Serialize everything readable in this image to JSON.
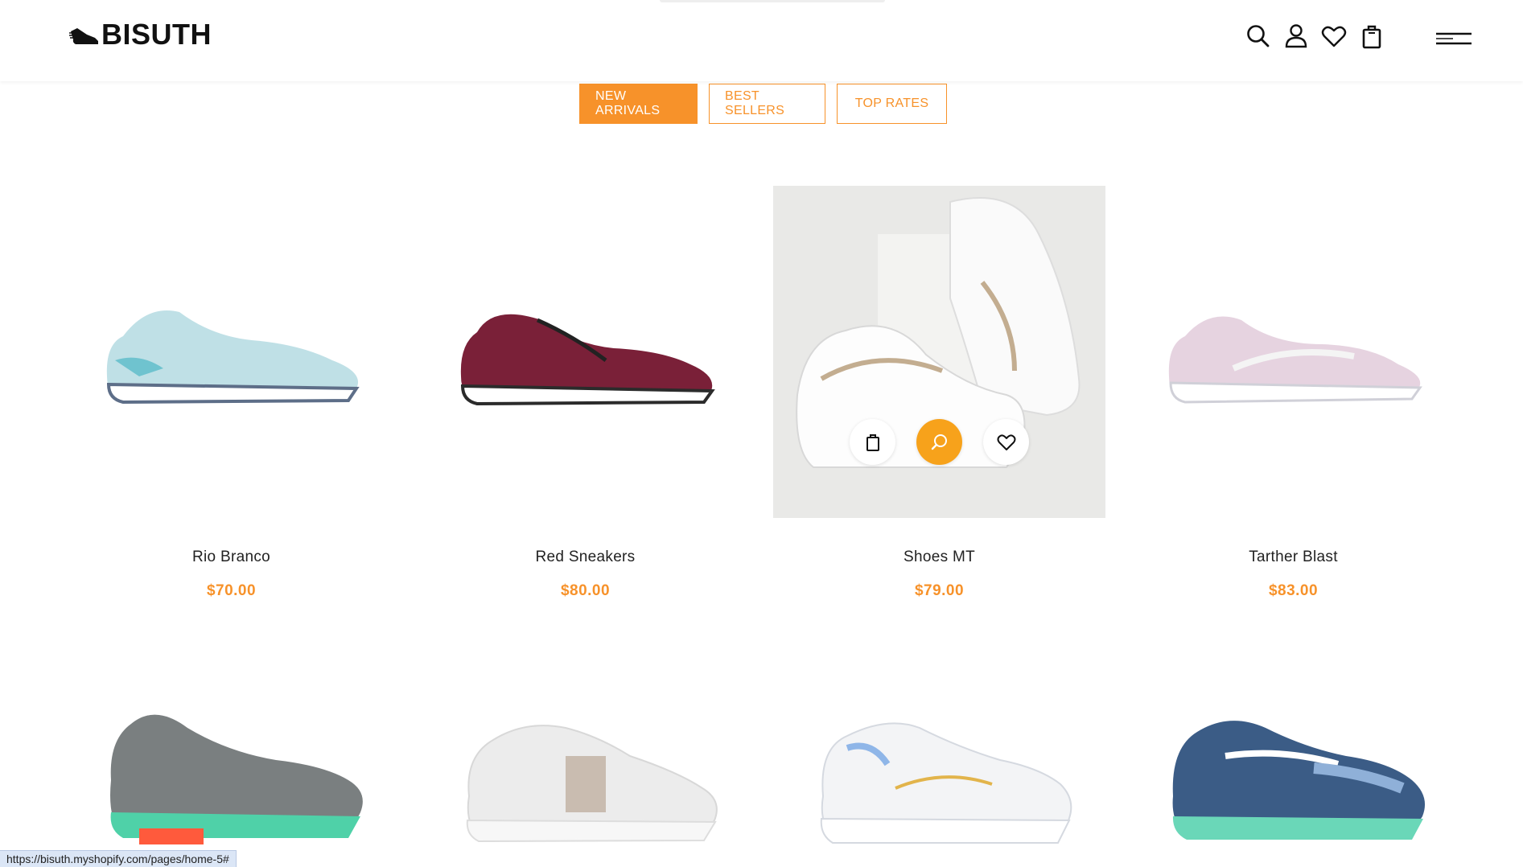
{
  "header": {
    "logo_text": "BISUTH",
    "icons": [
      "search-icon",
      "user-icon",
      "heart-icon",
      "bag-icon",
      "menu-icon"
    ]
  },
  "tabs": [
    {
      "label": "NEW ARRIVALS",
      "active": true
    },
    {
      "label": "BEST SELLERS",
      "active": false
    },
    {
      "label": "TOP RATES",
      "active": false
    }
  ],
  "products": [
    {
      "name": "Rio Branco",
      "price": "$70.00",
      "shoe_color": "#bfe0e6"
    },
    {
      "name": "Red Sneakers",
      "price": "$80.00",
      "shoe_color": "#7a2038"
    },
    {
      "name": "Shoes MT",
      "price": "$79.00",
      "shoe_color": "#f7f7f7"
    },
    {
      "name": "Tarther Blast",
      "price": "$83.00",
      "shoe_color": "#e6d3e0"
    }
  ],
  "products_row2": [
    {
      "shoe_color": "#7a7f80"
    },
    {
      "shoe_color": "#ececec"
    },
    {
      "shoe_color": "#f3f4f6"
    },
    {
      "shoe_color": "#3b5c86"
    }
  ],
  "status_bar": {
    "url": "https://bisuth.myshopify.com/pages/home-5#"
  },
  "colors": {
    "accent": "#f7922a",
    "action_primary": "#f7a21b"
  }
}
